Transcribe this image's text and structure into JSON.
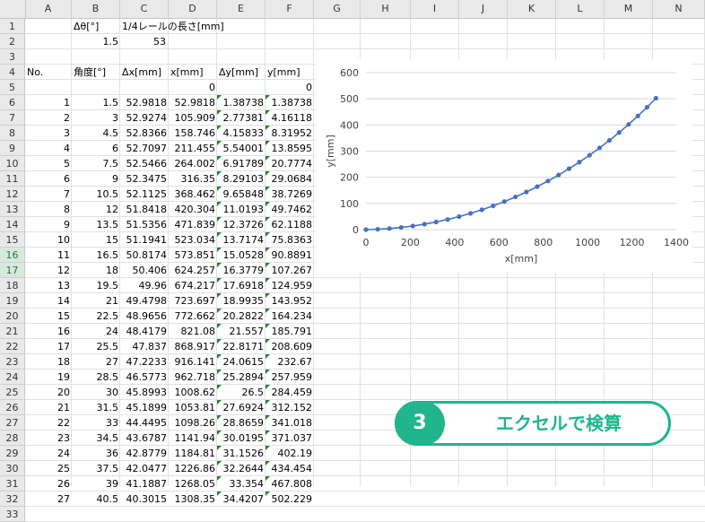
{
  "columns": [
    "A",
    "B",
    "C",
    "D",
    "E",
    "F",
    "G",
    "H",
    "I",
    "J",
    "K",
    "L",
    "M",
    "N"
  ],
  "row_numbers": [
    "1",
    "2",
    "3",
    "4",
    "5",
    "6",
    "7",
    "8",
    "9",
    "10",
    "11",
    "12",
    "13",
    "14",
    "15",
    "16",
    "17",
    "18",
    "19",
    "20",
    "21",
    "22",
    "23",
    "24",
    "25",
    "26",
    "27",
    "28",
    "29",
    "30",
    "31",
    "32",
    "33"
  ],
  "selected_rows": [
    "16",
    "17"
  ],
  "params": {
    "dtheta_label": "Δθ[°]",
    "rail_label": "1/4レールの長さ[mm]",
    "dtheta_value": "1.5",
    "rail_value": "53"
  },
  "table": {
    "headers": [
      "No.",
      "角度[°]",
      "Δx[mm]",
      "x[mm]",
      "Δy[mm]",
      "y[mm]"
    ],
    "initial_row": [
      "",
      "",
      "",
      "0",
      "",
      "0"
    ],
    "rows": [
      [
        "1",
        "1.5",
        "52.9818",
        "52.9818",
        "1.38738",
        "1.38738"
      ],
      [
        "2",
        "3",
        "52.9274",
        "105.909",
        "2.77381",
        "4.16118"
      ],
      [
        "3",
        "4.5",
        "52.8366",
        "158.746",
        "4.15833",
        "8.31952"
      ],
      [
        "4",
        "6",
        "52.7097",
        "211.455",
        "5.54001",
        "13.8595"
      ],
      [
        "5",
        "7.5",
        "52.5466",
        "264.002",
        "6.91789",
        "20.7774"
      ],
      [
        "6",
        "9",
        "52.3475",
        "316.35",
        "8.29103",
        "29.0684"
      ],
      [
        "7",
        "10.5",
        "52.1125",
        "368.462",
        "9.65848",
        "38.7269"
      ],
      [
        "8",
        "12",
        "51.8418",
        "420.304",
        "11.0193",
        "49.7462"
      ],
      [
        "9",
        "13.5",
        "51.5356",
        "471.839",
        "12.3726",
        "62.1188"
      ],
      [
        "10",
        "15",
        "51.1941",
        "523.034",
        "13.7174",
        "75.8363"
      ],
      [
        "11",
        "16.5",
        "50.8174",
        "573.851",
        "15.0528",
        "90.8891"
      ],
      [
        "12",
        "18",
        "50.406",
        "624.257",
        "16.3779",
        "107.267"
      ],
      [
        "13",
        "19.5",
        "49.96",
        "674.217",
        "17.6918",
        "124.959"
      ],
      [
        "14",
        "21",
        "49.4798",
        "723.697",
        "18.9935",
        "143.952"
      ],
      [
        "15",
        "22.5",
        "48.9656",
        "772.662",
        "20.2822",
        "164.234"
      ],
      [
        "16",
        "24",
        "48.4179",
        "821.08",
        "21.557",
        "185.791"
      ],
      [
        "17",
        "25.5",
        "47.837",
        "868.917",
        "22.8171",
        "208.609"
      ],
      [
        "18",
        "27",
        "47.2233",
        "916.141",
        "24.0615",
        "232.67"
      ],
      [
        "19",
        "28.5",
        "46.5773",
        "962.718",
        "25.2894",
        "257.959"
      ],
      [
        "20",
        "30",
        "45.8993",
        "1008.62",
        "26.5",
        "284.459"
      ],
      [
        "21",
        "31.5",
        "45.1899",
        "1053.81",
        "27.6924",
        "312.152"
      ],
      [
        "22",
        "33",
        "44.4495",
        "1098.26",
        "28.8659",
        "341.018"
      ],
      [
        "23",
        "34.5",
        "43.6787",
        "1141.94",
        "30.0195",
        "371.037"
      ],
      [
        "24",
        "36",
        "42.8779",
        "1184.81",
        "31.1526",
        "402.19"
      ],
      [
        "25",
        "37.5",
        "42.0477",
        "1226.86",
        "32.2644",
        "434.454"
      ],
      [
        "26",
        "39",
        "41.1887",
        "1268.05",
        "33.354",
        "467.808"
      ],
      [
        "27",
        "40.5",
        "40.3015",
        "1308.35",
        "34.4207",
        "502.229"
      ]
    ]
  },
  "chart_data": {
    "type": "scatter",
    "title": "",
    "xlabel": "x[mm]",
    "ylabel": "y[mm]",
    "xlim": [
      0,
      1400
    ],
    "ylim": [
      0,
      600
    ],
    "x_ticks": [
      "0",
      "200",
      "400",
      "600",
      "800",
      "1000",
      "1200",
      "1400"
    ],
    "y_ticks": [
      "0",
      "100",
      "200",
      "300",
      "400",
      "500",
      "600"
    ],
    "grid": "horizontal",
    "line": "smooth",
    "color": "#4472c4",
    "x": [
      0,
      52.9818,
      105.909,
      158.746,
      211.455,
      264.002,
      316.35,
      368.462,
      420.304,
      471.839,
      523.034,
      573.851,
      624.257,
      674.217,
      723.697,
      772.662,
      821.08,
      868.917,
      916.141,
      962.718,
      1008.62,
      1053.81,
      1098.26,
      1141.94,
      1184.81,
      1226.86,
      1268.05,
      1308.35
    ],
    "y": [
      0,
      1.38738,
      4.16118,
      8.31952,
      13.8595,
      20.7774,
      29.0684,
      38.7269,
      49.7462,
      62.1188,
      75.8363,
      90.8891,
      107.267,
      124.959,
      143.952,
      164.234,
      185.791,
      208.609,
      232.67,
      257.959,
      284.459,
      312.152,
      341.018,
      371.037,
      402.19,
      434.454,
      467.808,
      502.229
    ]
  },
  "badge": {
    "number": "3",
    "label": "エクセルで検算",
    "color": "#20b58d"
  }
}
